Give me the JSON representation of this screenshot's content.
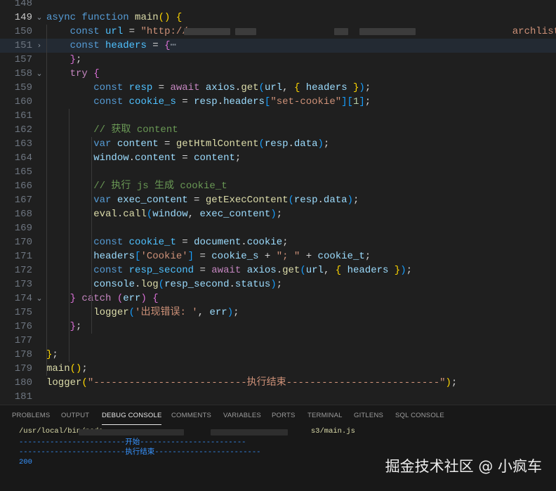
{
  "editor": {
    "lines": [
      {
        "num": "148",
        "fold": "",
        "tokens": []
      },
      {
        "num": "149",
        "fold": "⌄",
        "tokens": [
          [
            "t-kw",
            "async "
          ],
          [
            "t-kw",
            "function "
          ],
          [
            "t-fn",
            "main"
          ],
          [
            "t-p1",
            "()"
          ],
          [
            "t-plain",
            " "
          ],
          [
            "t-p1",
            "{"
          ]
        ]
      },
      {
        "num": "150",
        "fold": "",
        "tokens": [
          [
            "t-plain",
            "    "
          ],
          [
            "t-kw",
            "const "
          ],
          [
            "t-cvar",
            "url"
          ],
          [
            "t-plain",
            " = "
          ],
          [
            "t-str",
            "\"http://"
          ],
          [
            "t-str",
            "                                      "
          ],
          [
            "t-str",
            "                 "
          ],
          [
            "t-str",
            "archlist.dhtml\""
          ]
        ]
      },
      {
        "num": "151",
        "fold": "›",
        "tokens": [
          [
            "t-plain",
            "    "
          ],
          [
            "t-kw",
            "const "
          ],
          [
            "t-cvar",
            "headers"
          ],
          [
            "t-plain",
            " = "
          ],
          [
            "t-p2",
            "{"
          ],
          [
            "t-fold",
            "⋯"
          ]
        ]
      },
      {
        "num": "157",
        "fold": "",
        "tokens": [
          [
            "t-plain",
            "    "
          ],
          [
            "t-p2",
            "}"
          ],
          [
            "t-plain",
            ";"
          ]
        ]
      },
      {
        "num": "158",
        "fold": "⌄",
        "tokens": [
          [
            "t-plain",
            "    "
          ],
          [
            "t-ctl",
            "try "
          ],
          [
            "t-p2",
            "{"
          ]
        ]
      },
      {
        "num": "159",
        "fold": "",
        "tokens": [
          [
            "t-plain",
            "        "
          ],
          [
            "t-kw",
            "const "
          ],
          [
            "t-cvar",
            "resp"
          ],
          [
            "t-plain",
            " = "
          ],
          [
            "t-ctl",
            "await "
          ],
          [
            "t-var",
            "axios"
          ],
          [
            "t-plain",
            "."
          ],
          [
            "t-fn",
            "get"
          ],
          [
            "t-p3",
            "("
          ],
          [
            "t-var",
            "url"
          ],
          [
            "t-plain",
            ", "
          ],
          [
            "t-p1",
            "{ "
          ],
          [
            "t-var",
            "headers"
          ],
          [
            "t-p1",
            " }"
          ],
          [
            "t-p3",
            ")"
          ],
          [
            "t-plain",
            ";"
          ]
        ]
      },
      {
        "num": "160",
        "fold": "",
        "tokens": [
          [
            "t-plain",
            "        "
          ],
          [
            "t-kw",
            "const "
          ],
          [
            "t-cvar",
            "cookie_s"
          ],
          [
            "t-plain",
            " = "
          ],
          [
            "t-var",
            "resp"
          ],
          [
            "t-plain",
            "."
          ],
          [
            "t-var",
            "headers"
          ],
          [
            "t-p3",
            "["
          ],
          [
            "t-str",
            "\"set-cookie\""
          ],
          [
            "t-p3",
            "]"
          ],
          [
            "t-p3",
            "["
          ],
          [
            "t-num",
            "1"
          ],
          [
            "t-p3",
            "]"
          ],
          [
            "t-plain",
            ";"
          ]
        ]
      },
      {
        "num": "161",
        "fold": "",
        "tokens": []
      },
      {
        "num": "162",
        "fold": "",
        "tokens": [
          [
            "t-plain",
            "        "
          ],
          [
            "t-com",
            "// 获取 content"
          ]
        ]
      },
      {
        "num": "163",
        "fold": "",
        "tokens": [
          [
            "t-plain",
            "        "
          ],
          [
            "t-kw",
            "var "
          ],
          [
            "t-var",
            "content"
          ],
          [
            "t-plain",
            " = "
          ],
          [
            "t-fn",
            "getHtmlContent"
          ],
          [
            "t-p3",
            "("
          ],
          [
            "t-var",
            "resp"
          ],
          [
            "t-plain",
            "."
          ],
          [
            "t-var",
            "data"
          ],
          [
            "t-p3",
            ")"
          ],
          [
            "t-plain",
            ";"
          ]
        ]
      },
      {
        "num": "164",
        "fold": "",
        "tokens": [
          [
            "t-plain",
            "        "
          ],
          [
            "t-var",
            "window"
          ],
          [
            "t-plain",
            "."
          ],
          [
            "t-var",
            "content"
          ],
          [
            "t-plain",
            " = "
          ],
          [
            "t-var",
            "content"
          ],
          [
            "t-plain",
            ";"
          ]
        ]
      },
      {
        "num": "165",
        "fold": "",
        "tokens": []
      },
      {
        "num": "166",
        "fold": "",
        "tokens": [
          [
            "t-plain",
            "        "
          ],
          [
            "t-com",
            "// 执行 js 生成 cookie_t"
          ]
        ]
      },
      {
        "num": "167",
        "fold": "",
        "tokens": [
          [
            "t-plain",
            "        "
          ],
          [
            "t-kw",
            "var "
          ],
          [
            "t-var",
            "exec_content"
          ],
          [
            "t-plain",
            " = "
          ],
          [
            "t-fn",
            "getExecContent"
          ],
          [
            "t-p3",
            "("
          ],
          [
            "t-var",
            "resp"
          ],
          [
            "t-plain",
            "."
          ],
          [
            "t-var",
            "data"
          ],
          [
            "t-p3",
            ")"
          ],
          [
            "t-plain",
            ";"
          ]
        ]
      },
      {
        "num": "168",
        "fold": "",
        "tokens": [
          [
            "t-plain",
            "        "
          ],
          [
            "t-fn",
            "eval"
          ],
          [
            "t-plain",
            "."
          ],
          [
            "t-fn",
            "call"
          ],
          [
            "t-p3",
            "("
          ],
          [
            "t-var",
            "window"
          ],
          [
            "t-plain",
            ", "
          ],
          [
            "t-var",
            "exec_content"
          ],
          [
            "t-p3",
            ")"
          ],
          [
            "t-plain",
            ";"
          ]
        ]
      },
      {
        "num": "169",
        "fold": "",
        "tokens": []
      },
      {
        "num": "170",
        "fold": "",
        "tokens": [
          [
            "t-plain",
            "        "
          ],
          [
            "t-kw",
            "const "
          ],
          [
            "t-cvar",
            "cookie_t"
          ],
          [
            "t-plain",
            " = "
          ],
          [
            "t-var",
            "document"
          ],
          [
            "t-plain",
            "."
          ],
          [
            "t-var",
            "cookie"
          ],
          [
            "t-plain",
            ";"
          ]
        ]
      },
      {
        "num": "171",
        "fold": "",
        "tokens": [
          [
            "t-plain",
            "        "
          ],
          [
            "t-var",
            "headers"
          ],
          [
            "t-p3",
            "["
          ],
          [
            "t-str",
            "'Cookie'"
          ],
          [
            "t-p3",
            "]"
          ],
          [
            "t-plain",
            " = "
          ],
          [
            "t-var",
            "cookie_s"
          ],
          [
            "t-plain",
            " + "
          ],
          [
            "t-str",
            "\"; \""
          ],
          [
            "t-plain",
            " + "
          ],
          [
            "t-var",
            "cookie_t"
          ],
          [
            "t-plain",
            ";"
          ]
        ]
      },
      {
        "num": "172",
        "fold": "",
        "tokens": [
          [
            "t-plain",
            "        "
          ],
          [
            "t-kw",
            "const "
          ],
          [
            "t-cvar",
            "resp_second"
          ],
          [
            "t-plain",
            " = "
          ],
          [
            "t-ctl",
            "await "
          ],
          [
            "t-var",
            "axios"
          ],
          [
            "t-plain",
            "."
          ],
          [
            "t-fn",
            "get"
          ],
          [
            "t-p3",
            "("
          ],
          [
            "t-var",
            "url"
          ],
          [
            "t-plain",
            ", "
          ],
          [
            "t-p1",
            "{ "
          ],
          [
            "t-var",
            "headers"
          ],
          [
            "t-p1",
            " }"
          ],
          [
            "t-p3",
            ")"
          ],
          [
            "t-plain",
            ";"
          ]
        ]
      },
      {
        "num": "173",
        "fold": "",
        "tokens": [
          [
            "t-plain",
            "        "
          ],
          [
            "t-var",
            "console"
          ],
          [
            "t-plain",
            "."
          ],
          [
            "t-fn",
            "log"
          ],
          [
            "t-p3",
            "("
          ],
          [
            "t-var",
            "resp_second"
          ],
          [
            "t-plain",
            "."
          ],
          [
            "t-var",
            "status"
          ],
          [
            "t-p3",
            ")"
          ],
          [
            "t-plain",
            ";"
          ]
        ]
      },
      {
        "num": "174",
        "fold": "⌄",
        "tokens": [
          [
            "t-plain",
            "    "
          ],
          [
            "t-p2",
            "}"
          ],
          [
            "t-plain",
            " "
          ],
          [
            "t-ctl",
            "catch "
          ],
          [
            "t-p2",
            "("
          ],
          [
            "t-var",
            "err"
          ],
          [
            "t-p2",
            ")"
          ],
          [
            "t-plain",
            " "
          ],
          [
            "t-p2",
            "{"
          ]
        ]
      },
      {
        "num": "175",
        "fold": "",
        "tokens": [
          [
            "t-plain",
            "        "
          ],
          [
            "t-fn",
            "logger"
          ],
          [
            "t-p3",
            "("
          ],
          [
            "t-str",
            "'出现错误: '"
          ],
          [
            "t-plain",
            ", "
          ],
          [
            "t-var",
            "err"
          ],
          [
            "t-p3",
            ")"
          ],
          [
            "t-plain",
            ";"
          ]
        ]
      },
      {
        "num": "176",
        "fold": "",
        "tokens": [
          [
            "t-plain",
            "    "
          ],
          [
            "t-p2",
            "}"
          ],
          [
            "t-plain",
            ";"
          ]
        ]
      },
      {
        "num": "177",
        "fold": "",
        "tokens": []
      },
      {
        "num": "178",
        "fold": "",
        "tokens": [
          [
            "t-p1",
            "}"
          ],
          [
            "t-plain",
            ";"
          ]
        ]
      },
      {
        "num": "179",
        "fold": "",
        "tokens": [
          [
            "t-fn",
            "main"
          ],
          [
            "t-p1",
            "()"
          ],
          [
            "t-plain",
            ";"
          ]
        ]
      },
      {
        "num": "180",
        "fold": "",
        "tokens": [
          [
            "t-fn",
            "logger"
          ],
          [
            "t-p1",
            "("
          ],
          [
            "t-str",
            "\"--------------------------执行结束--------------------------\""
          ],
          [
            "t-p1",
            ")"
          ],
          [
            "t-plain",
            ";"
          ]
        ]
      },
      {
        "num": "181",
        "fold": "",
        "tokens": []
      }
    ]
  },
  "panel": {
    "tabs": [
      "PROBLEMS",
      "OUTPUT",
      "DEBUG CONSOLE",
      "COMMENTS",
      "VARIABLES",
      "PORTS",
      "TERMINAL",
      "GITLENS",
      "SQL CONSOLE"
    ],
    "active_tab": "DEBUG CONSOLE",
    "output": {
      "command": "/usr/local/bin/node                                               s3/main.js",
      "start": "------------------------开始------------------------",
      "end": "------------------------执行结束------------------------",
      "status": "200"
    }
  },
  "watermark": "掘金技术社区 @ 小疯车"
}
